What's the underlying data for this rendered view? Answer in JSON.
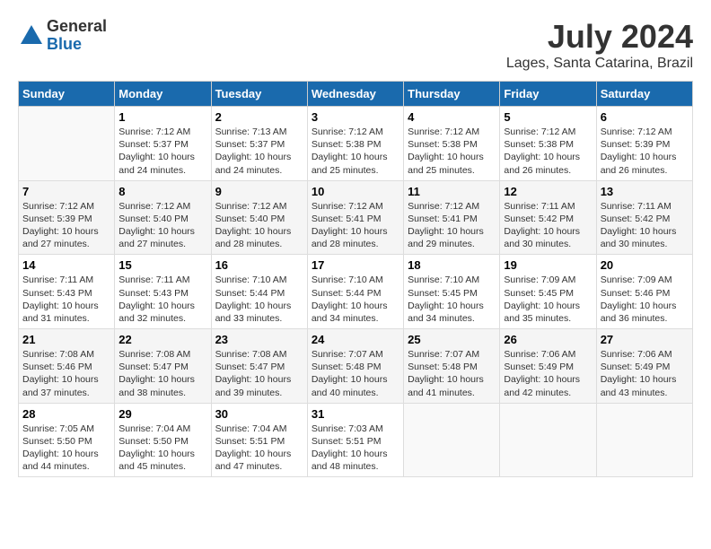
{
  "header": {
    "logo_general": "General",
    "logo_blue": "Blue",
    "month_title": "July 2024",
    "location": "Lages, Santa Catarina, Brazil"
  },
  "weekdays": [
    "Sunday",
    "Monday",
    "Tuesday",
    "Wednesday",
    "Thursday",
    "Friday",
    "Saturday"
  ],
  "weeks": [
    [
      {
        "day": "",
        "info": ""
      },
      {
        "day": "1",
        "info": "Sunrise: 7:12 AM\nSunset: 5:37 PM\nDaylight: 10 hours\nand 24 minutes."
      },
      {
        "day": "2",
        "info": "Sunrise: 7:13 AM\nSunset: 5:37 PM\nDaylight: 10 hours\nand 24 minutes."
      },
      {
        "day": "3",
        "info": "Sunrise: 7:12 AM\nSunset: 5:38 PM\nDaylight: 10 hours\nand 25 minutes."
      },
      {
        "day": "4",
        "info": "Sunrise: 7:12 AM\nSunset: 5:38 PM\nDaylight: 10 hours\nand 25 minutes."
      },
      {
        "day": "5",
        "info": "Sunrise: 7:12 AM\nSunset: 5:38 PM\nDaylight: 10 hours\nand 26 minutes."
      },
      {
        "day": "6",
        "info": "Sunrise: 7:12 AM\nSunset: 5:39 PM\nDaylight: 10 hours\nand 26 minutes."
      }
    ],
    [
      {
        "day": "7",
        "info": "Sunrise: 7:12 AM\nSunset: 5:39 PM\nDaylight: 10 hours\nand 27 minutes."
      },
      {
        "day": "8",
        "info": "Sunrise: 7:12 AM\nSunset: 5:40 PM\nDaylight: 10 hours\nand 27 minutes."
      },
      {
        "day": "9",
        "info": "Sunrise: 7:12 AM\nSunset: 5:40 PM\nDaylight: 10 hours\nand 28 minutes."
      },
      {
        "day": "10",
        "info": "Sunrise: 7:12 AM\nSunset: 5:41 PM\nDaylight: 10 hours\nand 28 minutes."
      },
      {
        "day": "11",
        "info": "Sunrise: 7:12 AM\nSunset: 5:41 PM\nDaylight: 10 hours\nand 29 minutes."
      },
      {
        "day": "12",
        "info": "Sunrise: 7:11 AM\nSunset: 5:42 PM\nDaylight: 10 hours\nand 30 minutes."
      },
      {
        "day": "13",
        "info": "Sunrise: 7:11 AM\nSunset: 5:42 PM\nDaylight: 10 hours\nand 30 minutes."
      }
    ],
    [
      {
        "day": "14",
        "info": "Sunrise: 7:11 AM\nSunset: 5:43 PM\nDaylight: 10 hours\nand 31 minutes."
      },
      {
        "day": "15",
        "info": "Sunrise: 7:11 AM\nSunset: 5:43 PM\nDaylight: 10 hours\nand 32 minutes."
      },
      {
        "day": "16",
        "info": "Sunrise: 7:10 AM\nSunset: 5:44 PM\nDaylight: 10 hours\nand 33 minutes."
      },
      {
        "day": "17",
        "info": "Sunrise: 7:10 AM\nSunset: 5:44 PM\nDaylight: 10 hours\nand 34 minutes."
      },
      {
        "day": "18",
        "info": "Sunrise: 7:10 AM\nSunset: 5:45 PM\nDaylight: 10 hours\nand 34 minutes."
      },
      {
        "day": "19",
        "info": "Sunrise: 7:09 AM\nSunset: 5:45 PM\nDaylight: 10 hours\nand 35 minutes."
      },
      {
        "day": "20",
        "info": "Sunrise: 7:09 AM\nSunset: 5:46 PM\nDaylight: 10 hours\nand 36 minutes."
      }
    ],
    [
      {
        "day": "21",
        "info": "Sunrise: 7:08 AM\nSunset: 5:46 PM\nDaylight: 10 hours\nand 37 minutes."
      },
      {
        "day": "22",
        "info": "Sunrise: 7:08 AM\nSunset: 5:47 PM\nDaylight: 10 hours\nand 38 minutes."
      },
      {
        "day": "23",
        "info": "Sunrise: 7:08 AM\nSunset: 5:47 PM\nDaylight: 10 hours\nand 39 minutes."
      },
      {
        "day": "24",
        "info": "Sunrise: 7:07 AM\nSunset: 5:48 PM\nDaylight: 10 hours\nand 40 minutes."
      },
      {
        "day": "25",
        "info": "Sunrise: 7:07 AM\nSunset: 5:48 PM\nDaylight: 10 hours\nand 41 minutes."
      },
      {
        "day": "26",
        "info": "Sunrise: 7:06 AM\nSunset: 5:49 PM\nDaylight: 10 hours\nand 42 minutes."
      },
      {
        "day": "27",
        "info": "Sunrise: 7:06 AM\nSunset: 5:49 PM\nDaylight: 10 hours\nand 43 minutes."
      }
    ],
    [
      {
        "day": "28",
        "info": "Sunrise: 7:05 AM\nSunset: 5:50 PM\nDaylight: 10 hours\nand 44 minutes."
      },
      {
        "day": "29",
        "info": "Sunrise: 7:04 AM\nSunset: 5:50 PM\nDaylight: 10 hours\nand 45 minutes."
      },
      {
        "day": "30",
        "info": "Sunrise: 7:04 AM\nSunset: 5:51 PM\nDaylight: 10 hours\nand 47 minutes."
      },
      {
        "day": "31",
        "info": "Sunrise: 7:03 AM\nSunset: 5:51 PM\nDaylight: 10 hours\nand 48 minutes."
      },
      {
        "day": "",
        "info": ""
      },
      {
        "day": "",
        "info": ""
      },
      {
        "day": "",
        "info": ""
      }
    ]
  ]
}
